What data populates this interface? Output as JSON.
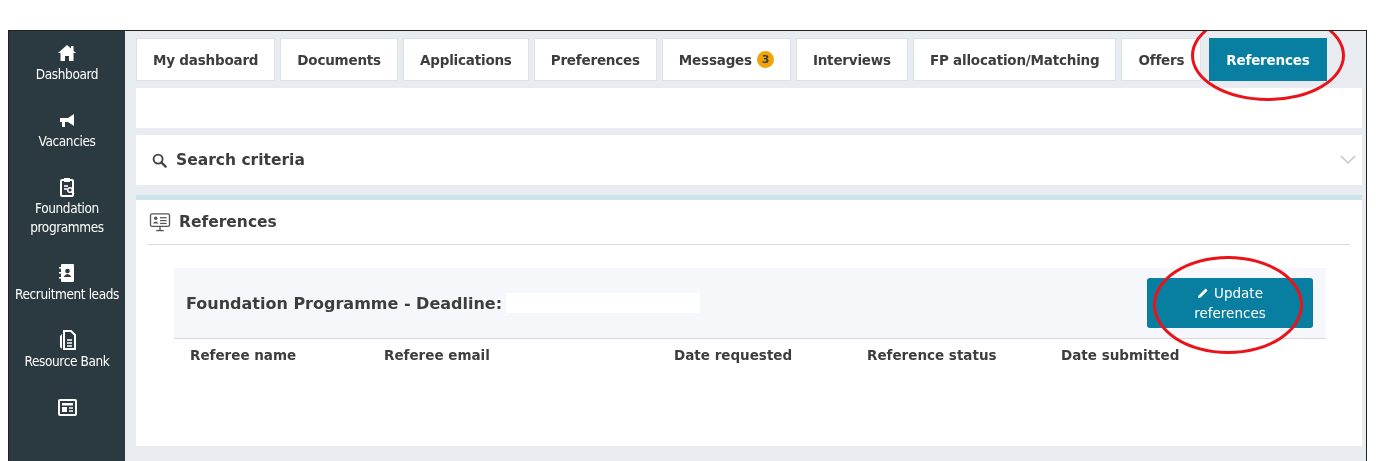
{
  "sidebar": {
    "items": [
      {
        "kind": "labelled",
        "label": "Dashboard"
      },
      {
        "kind": "labelled",
        "label": "Vacancies"
      },
      {
        "kind": "labelled",
        "label": "Foundation programmes"
      },
      {
        "kind": "labelled",
        "label": "Recruitment leads"
      },
      {
        "kind": "labelled",
        "label": "Resource Bank"
      },
      {
        "kind": "icon_only"
      }
    ]
  },
  "tabs": [
    {
      "label": "My dashboard",
      "selected": false,
      "circled": false
    },
    {
      "label": "Documents",
      "selected": false,
      "circled": false
    },
    {
      "label": "Applications",
      "selected": false,
      "circled": false
    },
    {
      "label": "Preferences",
      "selected": false,
      "circled": false
    },
    {
      "label": "Messages",
      "badge": "3",
      "selected": false,
      "circled": false
    },
    {
      "label": "Interviews",
      "selected": false,
      "circled": false
    },
    {
      "label": "FP allocation/Matching",
      "selected": false,
      "circled": false
    },
    {
      "label": "Offers",
      "selected": false,
      "circled": false
    },
    {
      "label": "References",
      "selected": true,
      "circled": true
    }
  ],
  "search_panel": {
    "title": "Search criteria",
    "expanded": false
  },
  "references_panel": {
    "title": "References",
    "programme": {
      "title": "Foundation Programme - Deadline:",
      "deadline_redacted": true,
      "button": {
        "label": "Update references",
        "circled": true
      },
      "columns": [
        "Referee name",
        "Referee email",
        "Date requested",
        "Reference status",
        "Date submitted"
      ]
    }
  }
}
